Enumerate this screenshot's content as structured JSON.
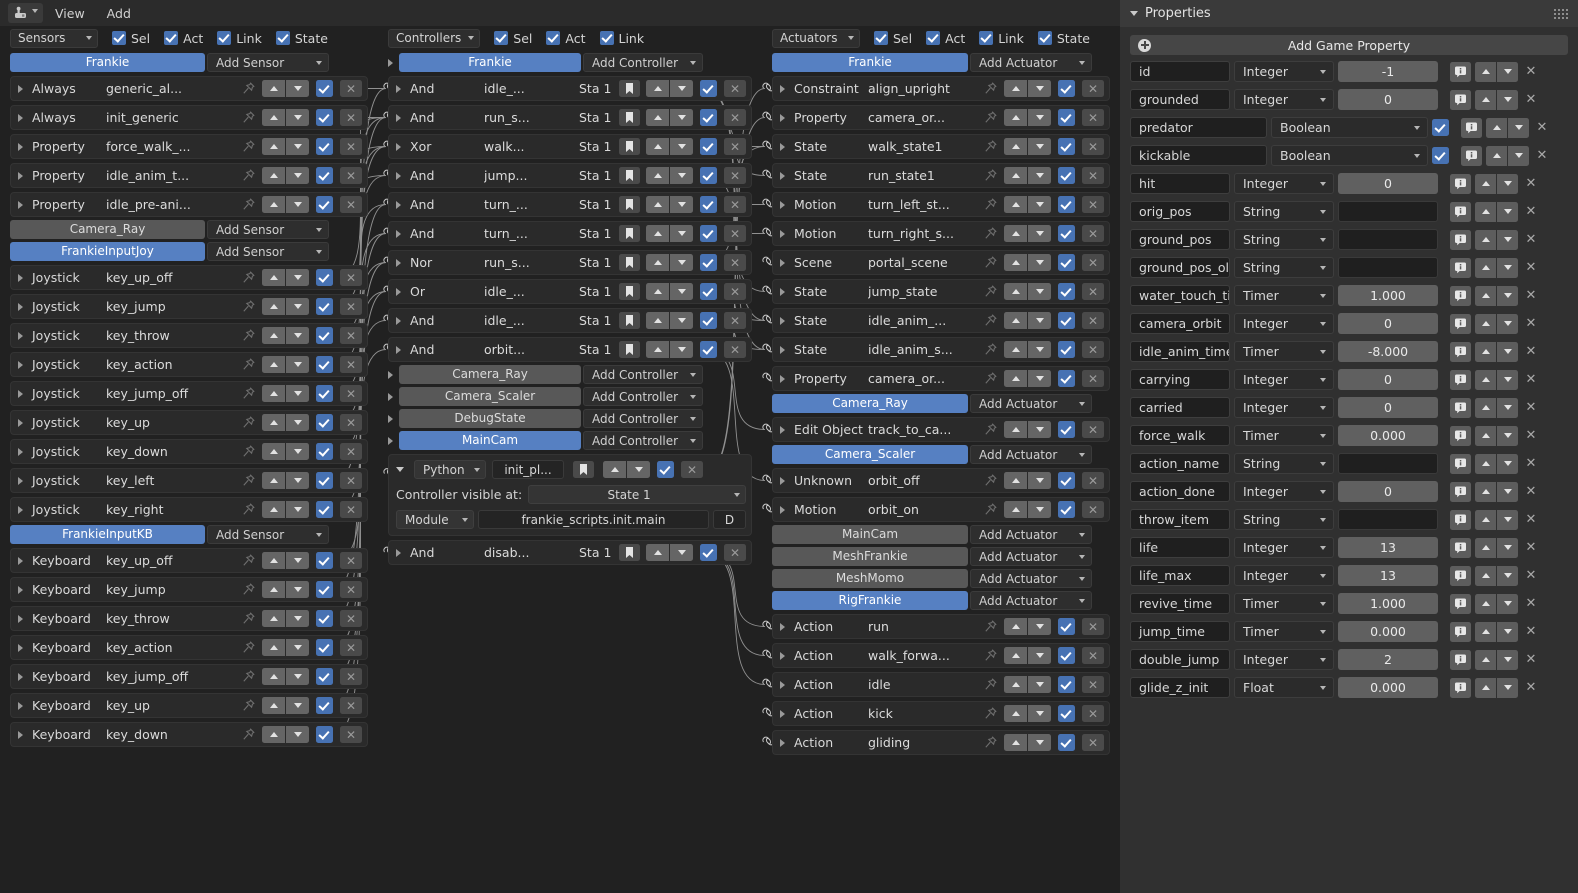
{
  "menubar": {
    "editor_icon": "logic-editor-icon",
    "items": [
      "View",
      "Add"
    ]
  },
  "columns": [
    {
      "id": "sensors",
      "type_label": "Sensors",
      "toggles": [
        {
          "label": "Sel",
          "checked": true
        },
        {
          "label": "Act",
          "checked": true
        },
        {
          "label": "Link",
          "checked": true
        },
        {
          "label": "State",
          "checked": true
        }
      ],
      "add_label": "Add Sensor",
      "groups": [
        {
          "object": "Frankie",
          "active": true,
          "bricks": [
            {
              "type": "Always",
              "name": "generic_al...",
              "enabled": true
            },
            {
              "type": "Always",
              "name": "init_generic",
              "enabled": true
            },
            {
              "type": "Property",
              "name": "force_walk_...",
              "enabled": true
            },
            {
              "type": "Property",
              "name": "idle_anim_t...",
              "enabled": true
            },
            {
              "type": "Property",
              "name": "idle_pre-ani...",
              "enabled": true
            }
          ]
        },
        {
          "object": "Camera_Ray",
          "active": false,
          "bricks": []
        },
        {
          "object": "FrankieInputJoy",
          "active": true,
          "bricks": [
            {
              "type": "Joystick",
              "name": "key_up_off",
              "enabled": true
            },
            {
              "type": "Joystick",
              "name": "key_jump",
              "enabled": true
            },
            {
              "type": "Joystick",
              "name": "key_throw",
              "enabled": true
            },
            {
              "type": "Joystick",
              "name": "key_action",
              "enabled": true
            },
            {
              "type": "Joystick",
              "name": "key_jump_off",
              "enabled": true
            },
            {
              "type": "Joystick",
              "name": "key_up",
              "enabled": true
            },
            {
              "type": "Joystick",
              "name": "key_down",
              "enabled": true
            },
            {
              "type": "Joystick",
              "name": "key_left",
              "enabled": true
            },
            {
              "type": "Joystick",
              "name": "key_right",
              "enabled": true
            }
          ]
        },
        {
          "object": "FrankieInputKB",
          "active": true,
          "bricks": [
            {
              "type": "Keyboard",
              "name": "key_up_off",
              "enabled": true
            },
            {
              "type": "Keyboard",
              "name": "key_jump",
              "enabled": true
            },
            {
              "type": "Keyboard",
              "name": "key_throw",
              "enabled": true
            },
            {
              "type": "Keyboard",
              "name": "key_action",
              "enabled": true
            },
            {
              "type": "Keyboard",
              "name": "key_jump_off",
              "enabled": true
            },
            {
              "type": "Keyboard",
              "name": "key_up",
              "enabled": true
            },
            {
              "type": "Keyboard",
              "name": "key_down",
              "enabled": true
            }
          ]
        }
      ]
    },
    {
      "id": "controllers",
      "type_label": "Controllers",
      "toggles": [
        {
          "label": "Sel",
          "checked": true
        },
        {
          "label": "Act",
          "checked": true
        },
        {
          "label": "Link",
          "checked": true
        }
      ],
      "add_label": "Add Controller",
      "groups": [
        {
          "object": "Frankie",
          "active": true,
          "bricks": [
            {
              "type": "And",
              "name": "idle_...",
              "state": "Sta 1",
              "enabled": true
            },
            {
              "type": "And",
              "name": "run_s...",
              "state": "Sta 1",
              "enabled": true
            },
            {
              "type": "Xor",
              "name": "walk...",
              "state": "Sta 1",
              "enabled": true
            },
            {
              "type": "And",
              "name": "jump...",
              "state": "Sta 1",
              "enabled": true
            },
            {
              "type": "And",
              "name": "turn_...",
              "state": "Sta 1",
              "enabled": true
            },
            {
              "type": "And",
              "name": "turn_...",
              "state": "Sta 1",
              "enabled": true
            },
            {
              "type": "Nor",
              "name": "run_s...",
              "state": "Sta 1",
              "enabled": true
            },
            {
              "type": "Or",
              "name": "idle_...",
              "state": "Sta 1",
              "enabled": true
            },
            {
              "type": "And",
              "name": "idle_...",
              "state": "Sta 1",
              "enabled": true
            },
            {
              "type": "And",
              "name": "orbit...",
              "state": "Sta 1",
              "enabled": true
            }
          ]
        },
        {
          "object": "Camera_Ray",
          "active": false,
          "bricks": []
        },
        {
          "object": "Camera_Scaler",
          "active": false,
          "bricks": []
        },
        {
          "object": "DebugState",
          "active": false,
          "bricks": []
        },
        {
          "object": "MainCam",
          "active": true,
          "bricks": [
            {
              "expanded": true,
              "type": "Python",
              "name": "init_pl...",
              "enabled": true,
              "visible_at_label": "Controller visible at:",
              "visible_at_value": "State 1",
              "mode": "Module",
              "module_path": "frankie_scripts.init.main",
              "debug_label": "D"
            },
            {
              "type": "And",
              "name": "disab...",
              "state": "Sta 1",
              "enabled": true
            }
          ]
        }
      ]
    },
    {
      "id": "actuators",
      "type_label": "Actuators",
      "toggles": [
        {
          "label": "Sel",
          "checked": true
        },
        {
          "label": "Act",
          "checked": true
        },
        {
          "label": "Link",
          "checked": true
        },
        {
          "label": "State",
          "checked": true
        }
      ],
      "add_label": "Add Actuator",
      "groups": [
        {
          "object": "Frankie",
          "active": true,
          "bricks": [
            {
              "type": "Constraint",
              "name": "align_upright",
              "enabled": true
            },
            {
              "type": "Property",
              "name": "camera_or...",
              "enabled": true
            },
            {
              "type": "State",
              "name": "walk_state1",
              "enabled": true
            },
            {
              "type": "State",
              "name": "run_state1",
              "enabled": true
            },
            {
              "type": "Motion",
              "name": "turn_left_st...",
              "enabled": true
            },
            {
              "type": "Motion",
              "name": "turn_right_s...",
              "enabled": true
            },
            {
              "type": "Scene",
              "name": "portal_scene",
              "enabled": true
            },
            {
              "type": "State",
              "name": "jump_state",
              "enabled": true
            },
            {
              "type": "State",
              "name": "idle_anim_...",
              "enabled": true
            },
            {
              "type": "State",
              "name": "idle_anim_s...",
              "enabled": true
            },
            {
              "type": "Property",
              "name": "camera_or...",
              "enabled": true
            }
          ]
        },
        {
          "object": "Camera_Ray",
          "active": true,
          "bricks": [
            {
              "type": "Edit Object",
              "name": "track_to_ca...",
              "enabled": true
            }
          ]
        },
        {
          "object": "Camera_Scaler",
          "active": true,
          "bricks": [
            {
              "type": "Unknown",
              "name": "orbit_off",
              "enabled": true
            },
            {
              "type": "Motion",
              "name": "orbit_on",
              "enabled": true
            }
          ]
        },
        {
          "object": "MainCam",
          "active": false,
          "bricks": []
        },
        {
          "object": "MeshFrankie",
          "active": false,
          "bricks": []
        },
        {
          "object": "MeshMomo",
          "active": false,
          "bricks": []
        },
        {
          "object": "RigFrankie",
          "active": true,
          "bricks": [
            {
              "type": "Action",
              "name": "run",
              "enabled": true
            },
            {
              "type": "Action",
              "name": "walk_forwa...",
              "enabled": true
            },
            {
              "type": "Action",
              "name": "idle",
              "enabled": true
            },
            {
              "type": "Action",
              "name": "kick",
              "enabled": true
            },
            {
              "type": "Action",
              "name": "gliding",
              "enabled": true,
              "expanded": true
            }
          ]
        }
      ]
    }
  ],
  "properties_panel": {
    "title": "Properties",
    "add_label": "Add Game Property",
    "grip_icon": "grip-dots-icon",
    "rows": [
      {
        "name": "id",
        "type": "Integer",
        "value": "-1"
      },
      {
        "name": "grounded",
        "type": "Integer",
        "value": "0"
      },
      {
        "name": "predator",
        "type": "Boolean",
        "bool": true
      },
      {
        "name": "kickable",
        "type": "Boolean",
        "bool": true
      },
      {
        "name": "hit",
        "type": "Integer",
        "value": "0"
      },
      {
        "name": "orig_pos",
        "type": "String",
        "value": ""
      },
      {
        "name": "ground_pos",
        "type": "String",
        "value": ""
      },
      {
        "name": "ground_pos_old",
        "type": "String",
        "value": ""
      },
      {
        "name": "water_touch_ti...",
        "type": "Timer",
        "value": "1.000"
      },
      {
        "name": "camera_orbit",
        "type": "Integer",
        "value": "0"
      },
      {
        "name": "idle_anim_timer",
        "type": "Timer",
        "value": "-8.000"
      },
      {
        "name": "carrying",
        "type": "Integer",
        "value": "0"
      },
      {
        "name": "carried",
        "type": "Integer",
        "value": "0"
      },
      {
        "name": "force_walk",
        "type": "Timer",
        "value": "0.000"
      },
      {
        "name": "action_name",
        "type": "String",
        "value": ""
      },
      {
        "name": "action_done",
        "type": "Integer",
        "value": "0"
      },
      {
        "name": "throw_item",
        "type": "String",
        "value": ""
      },
      {
        "name": "life",
        "type": "Integer",
        "value": "13"
      },
      {
        "name": "life_max",
        "type": "Integer",
        "value": "13"
      },
      {
        "name": "revive_time",
        "type": "Timer",
        "value": "1.000"
      },
      {
        "name": "jump_time",
        "type": "Timer",
        "value": "0.000"
      },
      {
        "name": "double_jump",
        "type": "Integer",
        "value": "2"
      },
      {
        "name": "glide_z_init",
        "type": "Float",
        "value": "0.000"
      }
    ]
  },
  "colors": {
    "accent": "#5680c2",
    "checkbox": "#4772b3",
    "panel_bg": "#303030",
    "editor_bg": "#212121",
    "brick_bg": "#2a2a2a"
  }
}
